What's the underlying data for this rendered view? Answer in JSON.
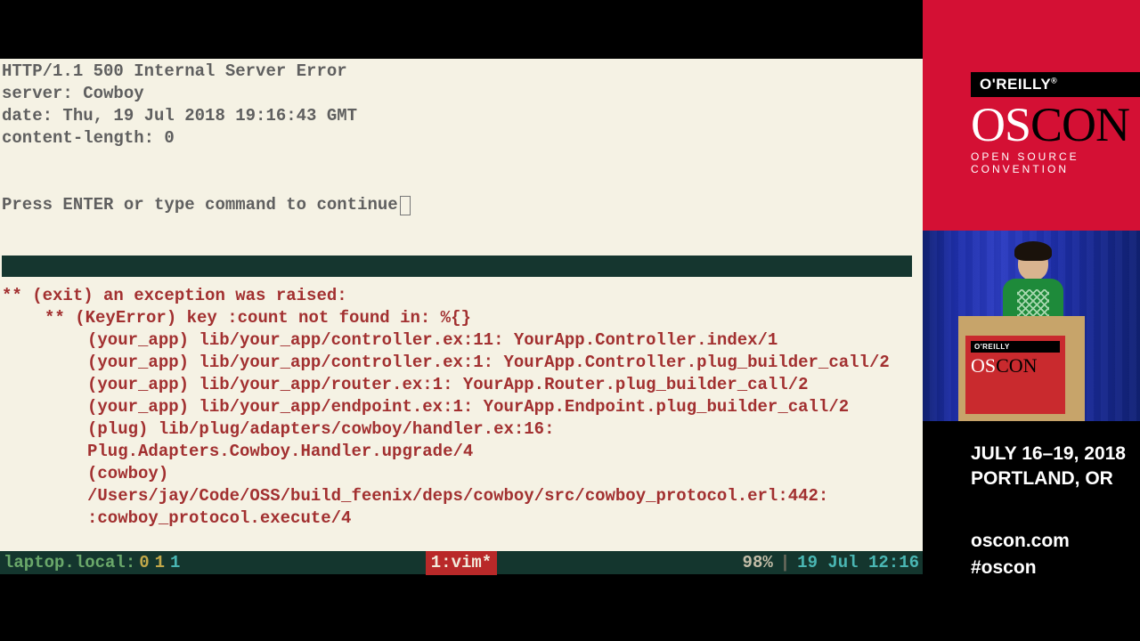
{
  "terminal": {
    "http": {
      "status_line": "HTTP/1.1 500 Internal Server Error",
      "server": "server: Cowboy",
      "date": "date: Thu, 19 Jul 2018 19:16:43 GMT",
      "content_length": "content-length: 0"
    },
    "prompt": "Press ENTER or type command to continue",
    "error": {
      "line0": "** (exit) an exception was raised:",
      "line1": "** (KeyError) key :count not found in: %{}",
      "line2": "(your_app) lib/your_app/controller.ex:11: YourApp.Controller.index/1",
      "line3": "(your_app) lib/your_app/controller.ex:1: YourApp.Controller.plug_builder_call/2",
      "line4": "(your_app) lib/your_app/router.ex:1: YourApp.Router.plug_builder_call/2",
      "line5": "(your_app) lib/your_app/endpoint.ex:1: YourApp.Endpoint.plug_builder_call/2",
      "line6": "(plug) lib/plug/adapters/cowboy/handler.ex:16: Plug.Adapters.Cowboy.Handler.upgrade/4",
      "line7": "(cowboy) /Users/jay/Code/OSS/build_feenix/deps/cowboy/src/cowboy_protocol.erl:442: :cowboy_protocol.execute/4"
    },
    "tmux": {
      "host": "laptop.local:",
      "n0": "0",
      "n1a": "1",
      "n1b": "1",
      "window": "1:vim*",
      "pct": "98%",
      "bar": "|",
      "date": "19 Jul 12:16"
    }
  },
  "sidebar": {
    "brand": "O'REILLY",
    "brand_mark": "®",
    "oscon_os": "OS",
    "oscon_con": "CON",
    "subtitle": "OPEN SOURCE CONVENTION",
    "dates": "JULY 16–19, 2018",
    "location": "PORTLAND, OR",
    "url": "oscon.com",
    "hashtag": "#oscon"
  }
}
